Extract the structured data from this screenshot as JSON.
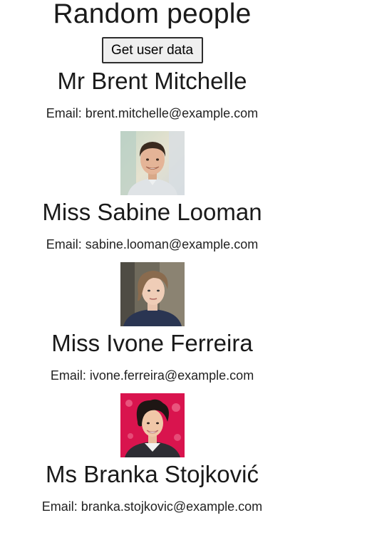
{
  "header": {
    "title": "Random people",
    "button_label": "Get user data"
  },
  "users": [
    {
      "name": "Mr Brent Mitchelle",
      "email_label": "Email: brent.mitchelle@example.com"
    },
    {
      "name": "Miss Sabine Looman",
      "email_label": "Email: sabine.looman@example.com"
    },
    {
      "name": "Miss Ivone Ferreira",
      "email_label": "Email: ivone.ferreira@example.com"
    },
    {
      "name": "Ms Branka Stojković",
      "email_label": "Email: branka.stojkovic@example.com"
    }
  ]
}
